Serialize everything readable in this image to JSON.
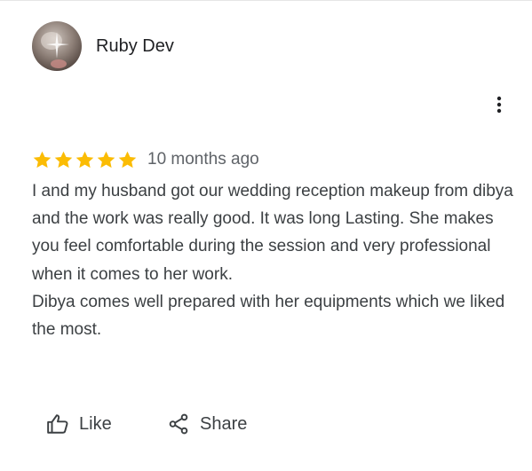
{
  "reviewer": {
    "name": "Ruby Dev"
  },
  "review": {
    "rating": 5,
    "max_rating": 5,
    "star_color": "#fbbc04",
    "date": "10 months ago",
    "paragraphs": [
      "I and my husband got our wedding reception makeup from dibya and the work was really good. It was long Lasting. She makes you feel comfortable during the session and very professional when it comes to her work.",
      "Dibya comes well prepared with her equipments which we liked the most."
    ]
  },
  "actions": {
    "like_label": "Like",
    "like_icon": "thumb-up-icon",
    "share_label": "Share",
    "share_icon": "share-icon",
    "more_icon": "more-vert-icon"
  }
}
